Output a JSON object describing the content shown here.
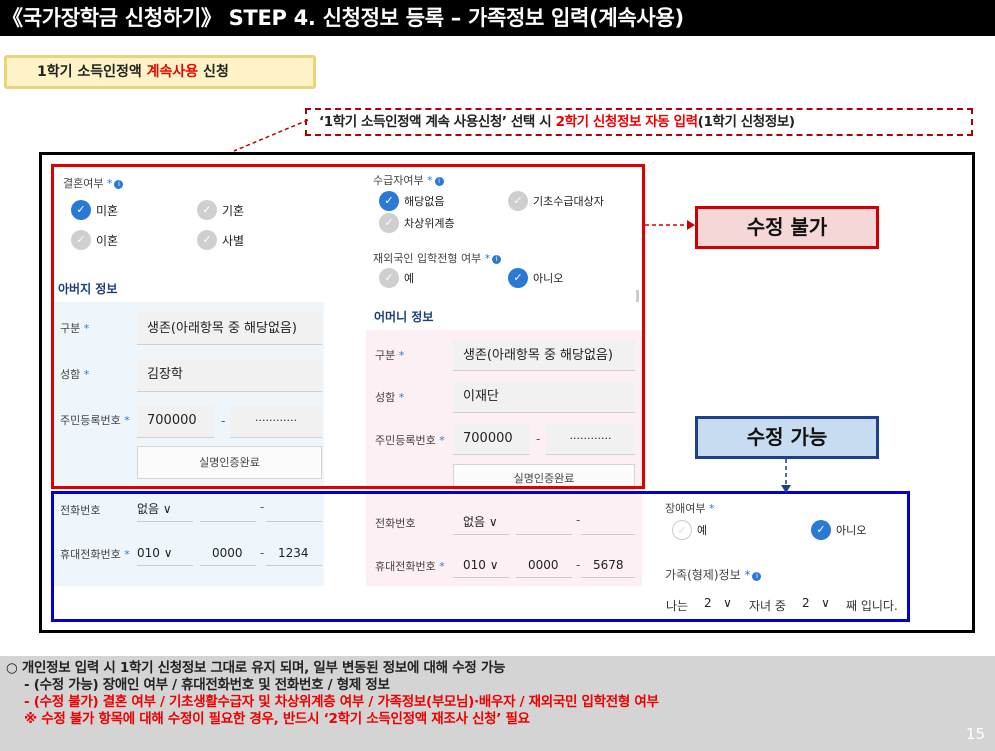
{
  "title": "《국가장학금 신청하기》 STEP 4. 신청정보 등록 – 가족정보 입력(계속사용)",
  "badge": {
    "pre": "1학기 소득인정액 ",
    "accent": "계속사용",
    "post": " 신청"
  },
  "note": {
    "pre": "‘1학기 소득인정액 계속 사용신청’ 선택 시 ",
    "accent": "2학기 신청정보 자동 입력",
    "post": "(1학기 신청정보)"
  },
  "form": {
    "marital": {
      "label": "결혼여부",
      "options": [
        "미혼",
        "기혼",
        "이혼",
        "사별"
      ],
      "selected": "미혼"
    },
    "recipient": {
      "label": "수급자여부",
      "options": [
        "해당없음",
        "기초수급대상자",
        "차상위계층"
      ],
      "selected": "해당없음"
    },
    "overseas": {
      "label": "재외국인 입학전형 여부",
      "options": [
        "예",
        "아니오"
      ],
      "selected": "아니오"
    },
    "father": {
      "section": "아버지 정보",
      "type_label": "구분",
      "type_value": "생존(아래항목 중 해당없음)",
      "name_label": "성함",
      "name_value": "김장학",
      "rrn_label": "주민등록번호",
      "rrn_front": "700000",
      "rrn_back": "············",
      "verify": "실명인증완료",
      "phone_label": "전화번호",
      "phone_value": "없음",
      "mobile_label": "휴대전화번호",
      "mobile_1": "010",
      "mobile_2": "0000",
      "mobile_3": "1234"
    },
    "mother": {
      "section": "어머니 정보",
      "type_label": "구분",
      "type_value": "생존(아래항목 중 해당없음)",
      "name_label": "성함",
      "name_value": "이재단",
      "rrn_label": "주민등록번호",
      "rrn_front": "700000",
      "rrn_back": "············",
      "verify": "실명인증완료",
      "phone_label": "전화번호",
      "phone_value": "없음",
      "mobile_label": "휴대전화번호",
      "mobile_1": "010",
      "mobile_2": "0000",
      "mobile_3": "5678"
    },
    "disability": {
      "label": "장애여부",
      "options": [
        "예",
        "아니오"
      ],
      "selected": "아니오"
    },
    "siblings": {
      "label": "가족(형제)정보",
      "t1": "나는",
      "v1": "2",
      "t2": "자녀 중",
      "v2": "2",
      "t3": "째 입니다."
    }
  },
  "callouts": {
    "no_edit": "수정 불가",
    "editable": "수정 가능"
  },
  "footer": {
    "line1": "○  개인정보 입력 시 1학기 신청정보 그대로 유지 되며, 일부 변동된 정보에 대해 수정 가능",
    "line2": "- (수정 가능) 장애인 여부 / 휴대전화번호 및 전화번호 / 형제 정보",
    "line3": "- (수정 불가) 결혼 여부 / 기초생활수급자 및 차상위계층 여부 / 가족정보(부모님)·배우자 / 재외국민 입학전형 여부",
    "line4": "※ 수정 불가 항목에 대해 수정이 필요한 경우, 반드시 ‘2학기 소득인정액 재조사 신청’ 필요"
  },
  "page_number": "15",
  "colors": {
    "accent_red": "#e00000",
    "accent_blue": "#0000d0",
    "check_blue": "#2b79d6"
  }
}
